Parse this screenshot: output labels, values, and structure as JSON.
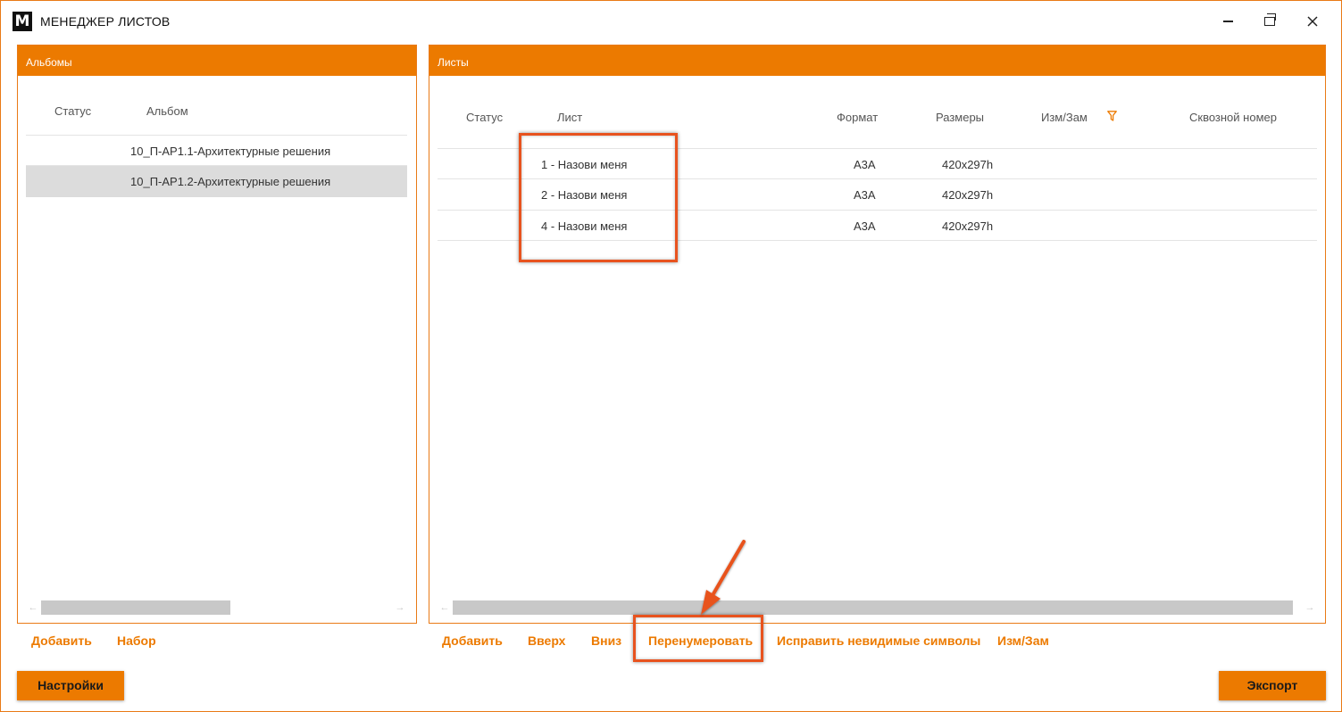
{
  "app": {
    "logo_letter": "M",
    "title": "МЕНЕДЖЕР ЛИСТОВ"
  },
  "albums_panel": {
    "header": "Альбомы",
    "columns": [
      "Статус",
      "Альбом"
    ],
    "rows": [
      {
        "status": "",
        "album": "10_П-АР1.1-Архитектурные решения"
      },
      {
        "status": "",
        "album": "10_П-АР1.2-Архитектурные решения",
        "selected": true
      }
    ],
    "actions": [
      "Добавить",
      "Набор"
    ]
  },
  "sheets_panel": {
    "header": "Листы",
    "columns": [
      "Статус",
      "Лист",
      "Формат",
      "Размеры",
      "Изм/Зам",
      "Сквозной номер"
    ],
    "rows": [
      {
        "status": "",
        "sheet": "1 - Назови меня",
        "format": "А3А",
        "size": "420x297h",
        "rev": "",
        "through_number": ""
      },
      {
        "status": "",
        "sheet": "2 - Назови меня",
        "format": "А3А",
        "size": "420x297h",
        "rev": "",
        "through_number": ""
      },
      {
        "status": "",
        "sheet": "4 - Назови меня",
        "format": "А3А",
        "size": "420x297h",
        "rev": "",
        "through_number": ""
      }
    ],
    "actions": [
      "Добавить",
      "Вверх",
      "Вниз",
      "Перенумеровать",
      "Исправить невидимые символы",
      "Изм/Зам"
    ]
  },
  "footer": {
    "settings_label": "Настройки",
    "export_label": "Экспорт"
  },
  "colors": {
    "accent": "#ec7a00",
    "annotation": "#e8531f",
    "selected_row": "#dcdcdc"
  },
  "icons": [
    "minimize-icon",
    "maximize-icon",
    "close-icon",
    "filter-icon",
    "arrow-left-icon",
    "arrow-right-icon"
  ]
}
